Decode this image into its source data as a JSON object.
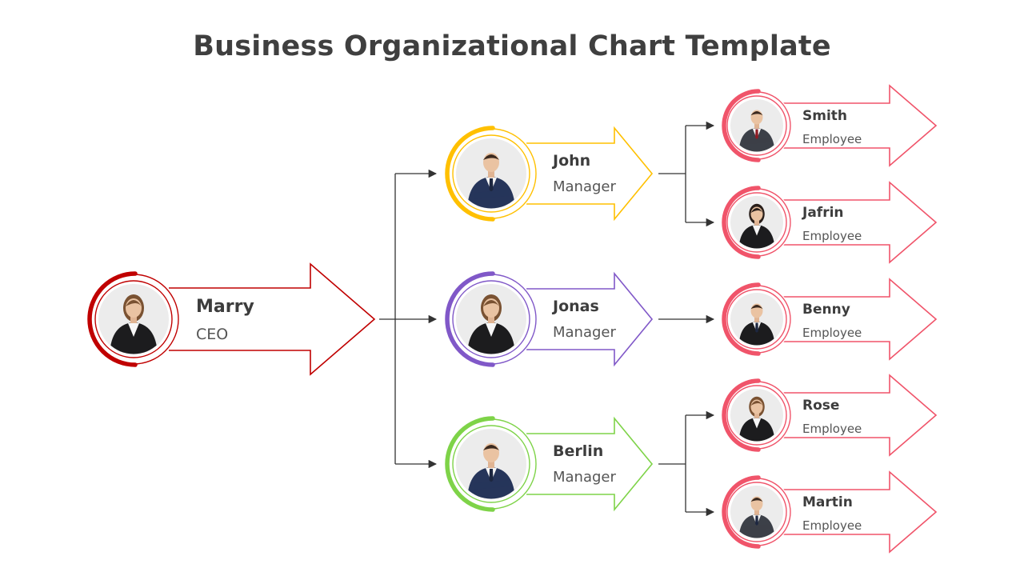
{
  "title": "Business Organizational Chart Template",
  "colors": {
    "connector": "#333333",
    "name_text": "#3d3d3d",
    "role_text": "#555555"
  },
  "ceo": {
    "id": "marry",
    "name": "Marry",
    "role": "CEO",
    "color": "#c00000",
    "avatar": "woman-black-blazer"
  },
  "managers": [
    {
      "id": "john",
      "name": "John",
      "role": "Manager",
      "color": "#ffc000",
      "avatar": "man-navy-suit",
      "reports": [
        "smith",
        "jafrin"
      ]
    },
    {
      "id": "jonas",
      "name": "Jonas",
      "role": "Manager",
      "color": "#8058c8",
      "avatar": "woman-black-blazer-long-hair",
      "reports": [
        "benny"
      ]
    },
    {
      "id": "berlin",
      "name": "Berlin",
      "role": "Manager",
      "color": "#7ed348",
      "avatar": "man-navy-blazer-beard",
      "reports": [
        "rose",
        "martin"
      ]
    }
  ],
  "employees": [
    {
      "id": "smith",
      "name": "Smith",
      "role": "Employee",
      "color": "#f0546a",
      "avatar": "man-grey-suit-red-tie"
    },
    {
      "id": "jafrin",
      "name": "Jafrin",
      "role": "Employee",
      "color": "#f0546a",
      "avatar": "woman-black-blazer-dark-hair"
    },
    {
      "id": "benny",
      "name": "Benny",
      "role": "Employee",
      "color": "#f0546a",
      "avatar": "man-black-suit"
    },
    {
      "id": "rose",
      "name": "Rose",
      "role": "Employee",
      "color": "#f0546a",
      "avatar": "woman-glasses-black-blazer"
    },
    {
      "id": "martin",
      "name": "Martin",
      "role": "Employee",
      "color": "#f0546a",
      "avatar": "man-charcoal-suit"
    }
  ]
}
